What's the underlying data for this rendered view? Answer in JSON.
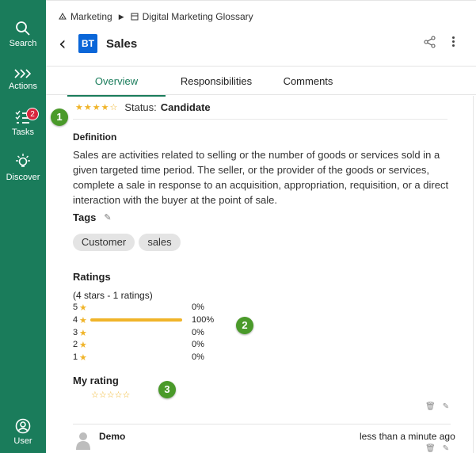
{
  "rail": {
    "search_label": "Search",
    "actions_label": "Actions",
    "tasks_label": "Tasks",
    "tasks_badge": "2",
    "discover_label": "Discover",
    "user_label": "User"
  },
  "breadcrumb": {
    "items": [
      "Marketing",
      "Digital Marketing Glossary"
    ]
  },
  "header": {
    "type_badge": "BT",
    "title": "Sales"
  },
  "tabs": [
    {
      "label": "Overview",
      "active": true
    },
    {
      "label": "Responsibilities",
      "active": false
    },
    {
      "label": "Comments",
      "active": false
    }
  ],
  "overview": {
    "rating_stars": "★★★★☆",
    "status_label": "Status:",
    "status_value": "Candidate",
    "definition_heading": "Definition",
    "definition_text": "Sales are activities related to selling or the number of goods or services sold in a given targeted time period. The seller, or the provider of the goods or services, complete a sale in response to an acquisition, appropriation, requisition, or a direct interaction with the buyer at the point of sale.",
    "tags_heading": "Tags",
    "tags": [
      "Customer",
      "sales"
    ],
    "ratings_heading": "Ratings",
    "ratings_summary": "(4 stars - 1 ratings)",
    "rating_rows": [
      {
        "stars": "5",
        "percent": 0,
        "label": "0%"
      },
      {
        "stars": "4",
        "percent": 100,
        "label": "100%"
      },
      {
        "stars": "3",
        "percent": 0,
        "label": "0%"
      },
      {
        "stars": "2",
        "percent": 0,
        "label": "0%"
      },
      {
        "stars": "1",
        "percent": 0,
        "label": "0%"
      }
    ],
    "my_rating_heading": "My rating",
    "my_rating_stars": "☆☆☆☆☆"
  },
  "comment": {
    "author": "Demo",
    "time": "less than a minute ago"
  },
  "callouts": [
    "1",
    "2",
    "3"
  ],
  "colors": {
    "rail": "#1a7c5b",
    "accent": "#1a7c5b",
    "star": "#f0b429",
    "badge_red": "#d7263d",
    "type_badge": "#0a66d8",
    "callout": "#4a9a2a"
  }
}
